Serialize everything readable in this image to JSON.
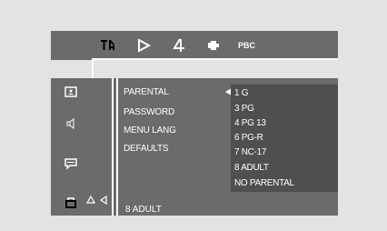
{
  "toolbar": {
    "tabs": [
      {
        "name": "settings-icon"
      },
      {
        "name": "play-icon"
      },
      {
        "name": "audio-icon"
      },
      {
        "name": "speaker-icon"
      },
      {
        "name": "pbc",
        "label": "PBC"
      }
    ]
  },
  "sidebar": {
    "icons": [
      "picture-icon",
      "sound-icon",
      "subtitle-icon",
      "lock-icon"
    ]
  },
  "menu": {
    "items": [
      "PARENTAL",
      "PASSWORD",
      "MENU LANG",
      "DEFAULTS"
    ],
    "active_index": 0
  },
  "submenu": {
    "options": [
      "1 G",
      "3 PG",
      "4 PG 13",
      "6 PG-R",
      "7 NC-17",
      "8 ADULT",
      "NO PARENTAL"
    ],
    "highlighted_index": 0
  },
  "footer": {
    "current_value": "8 ADULT"
  },
  "colors": {
    "background": "#e3e3e3",
    "panel": "#6b6b6b",
    "submenu": "#4f4f4f",
    "text": "#ffffff"
  }
}
